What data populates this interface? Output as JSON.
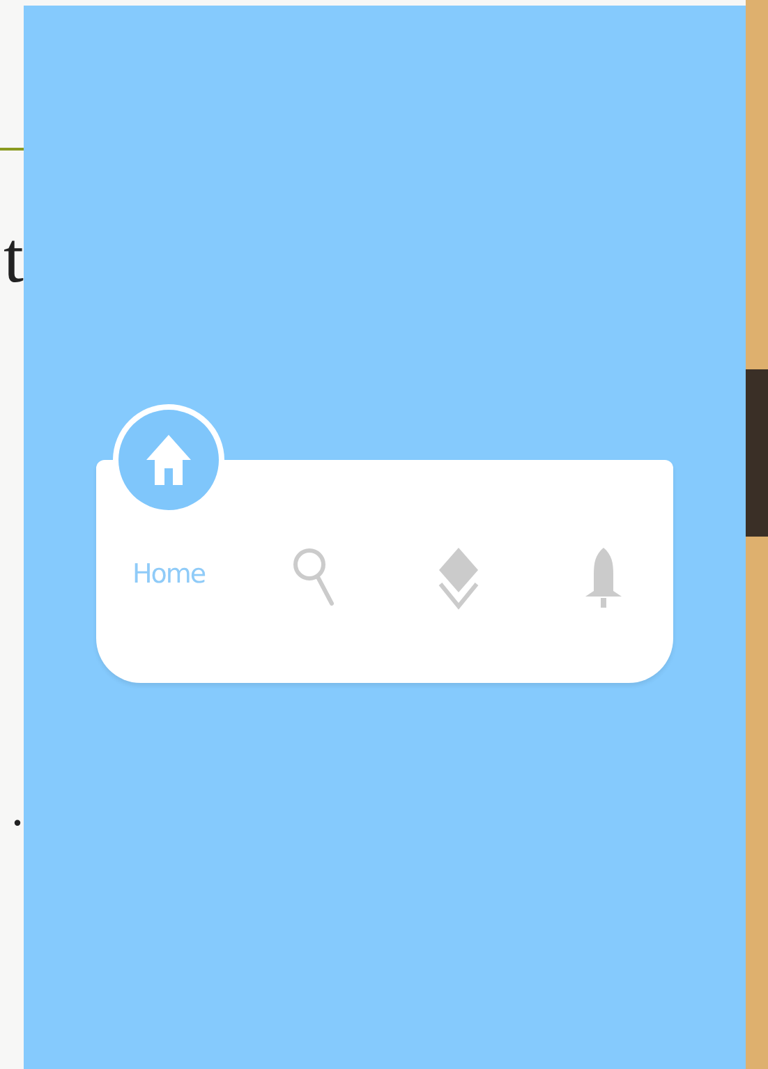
{
  "background_text": [
    "t",
    "."
  ],
  "tab_bar": {
    "tabs": [
      {
        "kind": "home",
        "label": "Home",
        "selected": true
      },
      {
        "kind": "search",
        "selected": false
      },
      {
        "kind": "layers",
        "selected": false
      },
      {
        "kind": "bell",
        "selected": false
      }
    ]
  }
}
